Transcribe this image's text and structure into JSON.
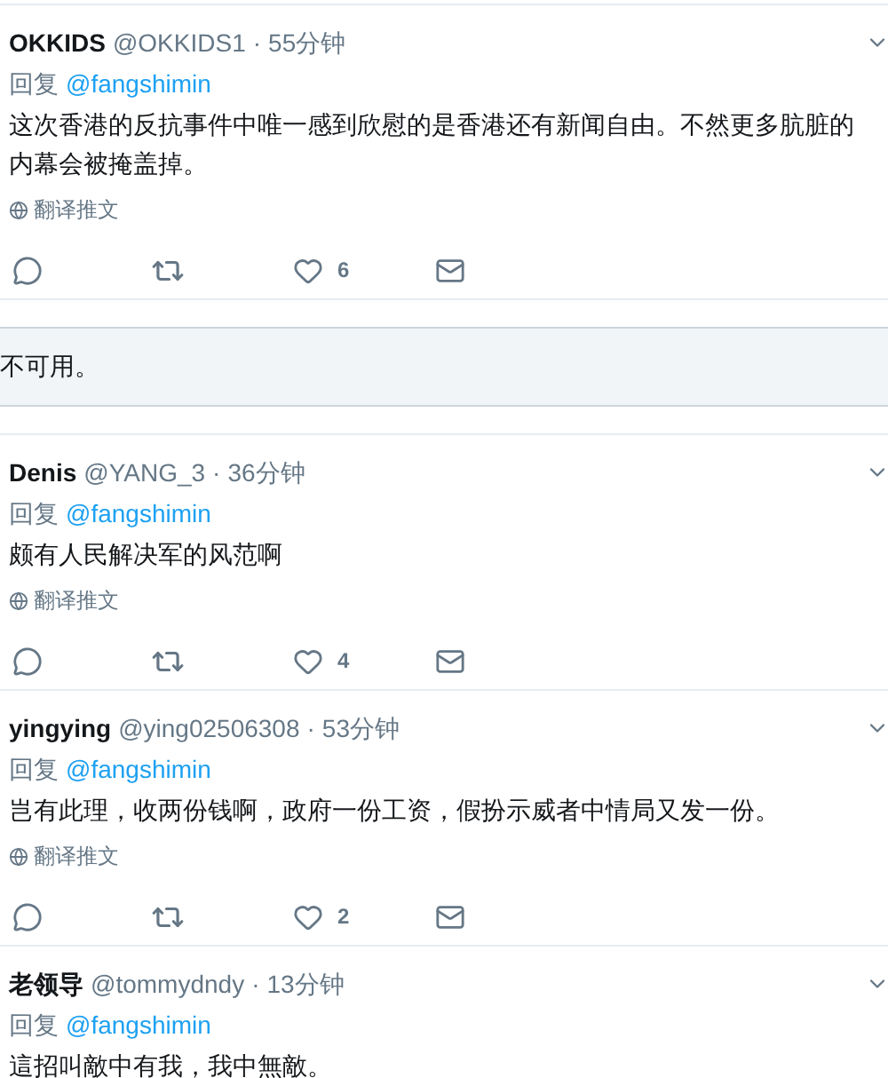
{
  "feed": [
    {
      "kind": "tweet",
      "name": "OKKIDS",
      "handle": "@OKKIDS1",
      "separator": "·",
      "time": "55分钟",
      "reply_label": "回复",
      "reply_to": "@fangshimin",
      "text": "这次香港的反抗事件中唯一感到欣慰的是香港还有新闻自由。不然更多肮脏的内幕会被掩盖掉。",
      "translate": "翻译推文",
      "likes": "6"
    },
    {
      "kind": "notice",
      "text": "不可用。"
    },
    {
      "kind": "tweet",
      "name": "Denis",
      "handle": "@YANG_3",
      "separator": "·",
      "time": "36分钟",
      "reply_label": "回复",
      "reply_to": "@fangshimin",
      "text": "颇有人民解决军的风范啊",
      "translate": "翻译推文",
      "likes": "4"
    },
    {
      "kind": "tweet",
      "name": "yingying",
      "handle": "@ying02506308",
      "separator": "·",
      "time": "53分钟",
      "reply_label": "回复",
      "reply_to": "@fangshimin",
      "text": "岂有此理，收两份钱啊，政府一份工资，假扮示威者中情局又发一份。",
      "translate": "翻译推文",
      "likes": "2"
    },
    {
      "kind": "tweet",
      "name": "老领导",
      "handle": "@tommydndy",
      "separator": "·",
      "time": "13分钟",
      "reply_label": "回复",
      "reply_to": "@fangshimin",
      "text": "這招叫敵中有我，我中無敵。"
    }
  ]
}
